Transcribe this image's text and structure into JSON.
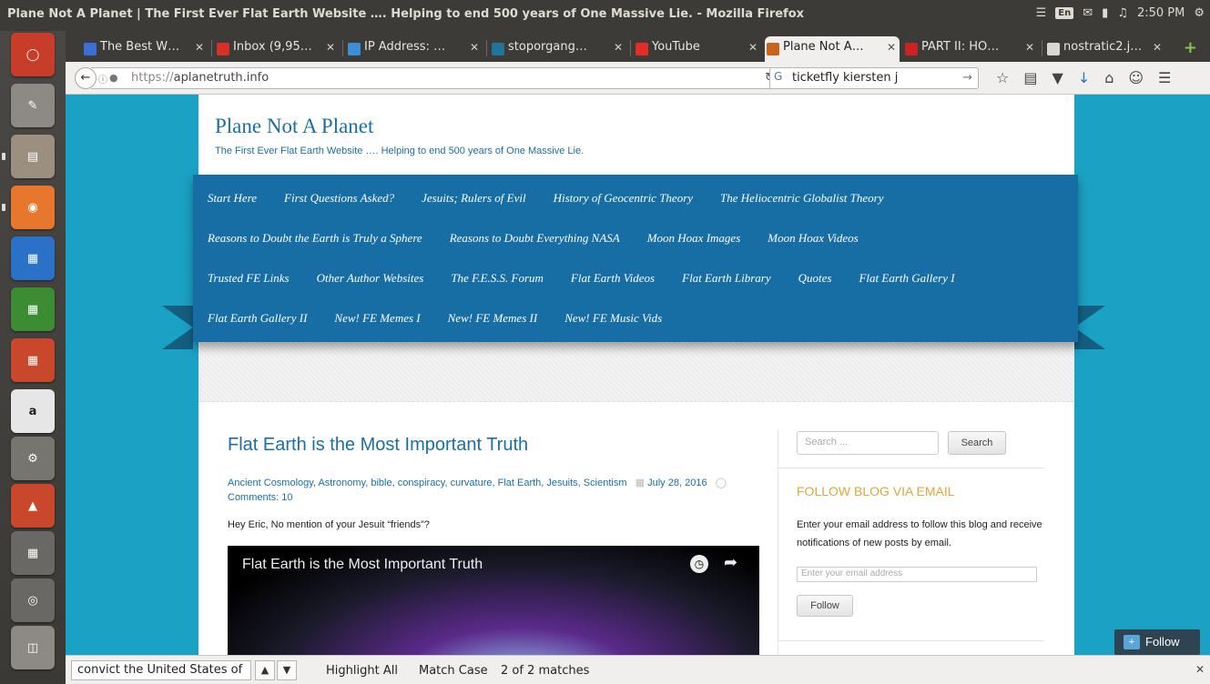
{
  "window": {
    "title": "Plane Not A Planet | The First Ever Flat Earth Website …. Helping to end 500 years of One Massive Lie. - Mozilla Firefox"
  },
  "indicators": {
    "keyboard": "En",
    "time": "2:50 PM"
  },
  "tabs": [
    {
      "label": "The Best W…",
      "favicon_color": "#3b6fd8"
    },
    {
      "label": "Inbox (9,95…",
      "favicon_color": "#d93025"
    },
    {
      "label": "IP Address: …",
      "favicon_color": "#3a8fd6"
    },
    {
      "label": "stoporgang…",
      "favicon_color": "#21759b"
    },
    {
      "label": "YouTube",
      "favicon_color": "#e52d27"
    },
    {
      "label": "Plane Not A…",
      "favicon_color": "#c8651b"
    },
    {
      "label": "PART II: HO…",
      "favicon_color": "#cc2222"
    },
    {
      "label": "nostratic2.j…",
      "favicon_color": "#d8d8d8"
    }
  ],
  "navbar": {
    "url_prefix": "https://",
    "url_host": "aplanetruth.info",
    "search_value": "ticketfly kiersten j"
  },
  "site": {
    "title": "Plane Not A Planet",
    "description": "The First Ever Flat Earth Website …. Helping to end 500 years of One Massive Lie."
  },
  "menu": {
    "row1": [
      "Start Here",
      "First Questions Asked?",
      "Jesuits; Rulers of Evil",
      "History of Geocentric Theory",
      "The Heliocentric Globalist Theory"
    ],
    "row2": [
      "Reasons to Doubt the Earth is Truly a Sphere",
      "Reasons to Doubt Everything NASA",
      "Moon Hoax Images",
      "Moon Hoax Videos"
    ],
    "row3": [
      "Trusted FE Links",
      "Other Author Websites",
      "The F.E.S.S. Forum",
      "Flat Earth Videos",
      "Flat Earth Library",
      "Quotes",
      "Flat Earth Gallery I"
    ],
    "row4": [
      "Flat Earth Gallery II",
      "New! FE Memes I",
      "New! FE Memes II",
      "New! FE Music Vids"
    ]
  },
  "post": {
    "title": "Flat Earth is the Most Important Truth",
    "categories": [
      "Ancient Cosmology",
      "Astronomy",
      "bible",
      "conspiracy",
      "curvature",
      "Flat Earth",
      "Jesuits",
      "Scientism"
    ],
    "date": "July 28, 2016",
    "comments": "Comments: 10",
    "excerpt": "Hey Eric, No mention of your Jesuit “friends”?",
    "video_title": "Flat Earth is the Most Important Truth"
  },
  "sidebar": {
    "search_placeholder": "Search ...",
    "search_button": "Search",
    "follow_heading": "FOLLOW BLOG VIA EMAIL",
    "follow_text": "Enter your email address to follow this blog and receive notifications of new posts by email.",
    "email_placeholder": "Enter your email address",
    "follow_button": "Follow"
  },
  "floating_follow": "Follow",
  "findbar": {
    "query": "convict the United States of",
    "highlight_all": "Highlight All",
    "match_case": "Match Case",
    "status": "2 of 2 matches"
  },
  "launcher": [
    {
      "name": "ubuntu-dash-icon",
      "color": "#c83d2a"
    },
    {
      "name": "text-editor-icon",
      "color": "#8d8a85"
    },
    {
      "name": "files-icon",
      "color": "#9b8f80"
    },
    {
      "name": "firefox-icon",
      "color": "#e8772e"
    },
    {
      "name": "impress-icon",
      "color": "#2a72c7"
    },
    {
      "name": "calc-icon",
      "color": "#3b8c33"
    },
    {
      "name": "impress-red-icon",
      "color": "#c9472b"
    },
    {
      "name": "amazon-icon",
      "color": "#e6e6e6"
    },
    {
      "name": "settings-icon",
      "color": "#777570"
    },
    {
      "name": "software-center-icon",
      "color": "#c9472b"
    },
    {
      "name": "workspace-icon",
      "color": "#6a6864"
    },
    {
      "name": "dvd-icon",
      "color": "#6a6864"
    },
    {
      "name": "trash-icon",
      "color": "#8d8a85"
    }
  ]
}
